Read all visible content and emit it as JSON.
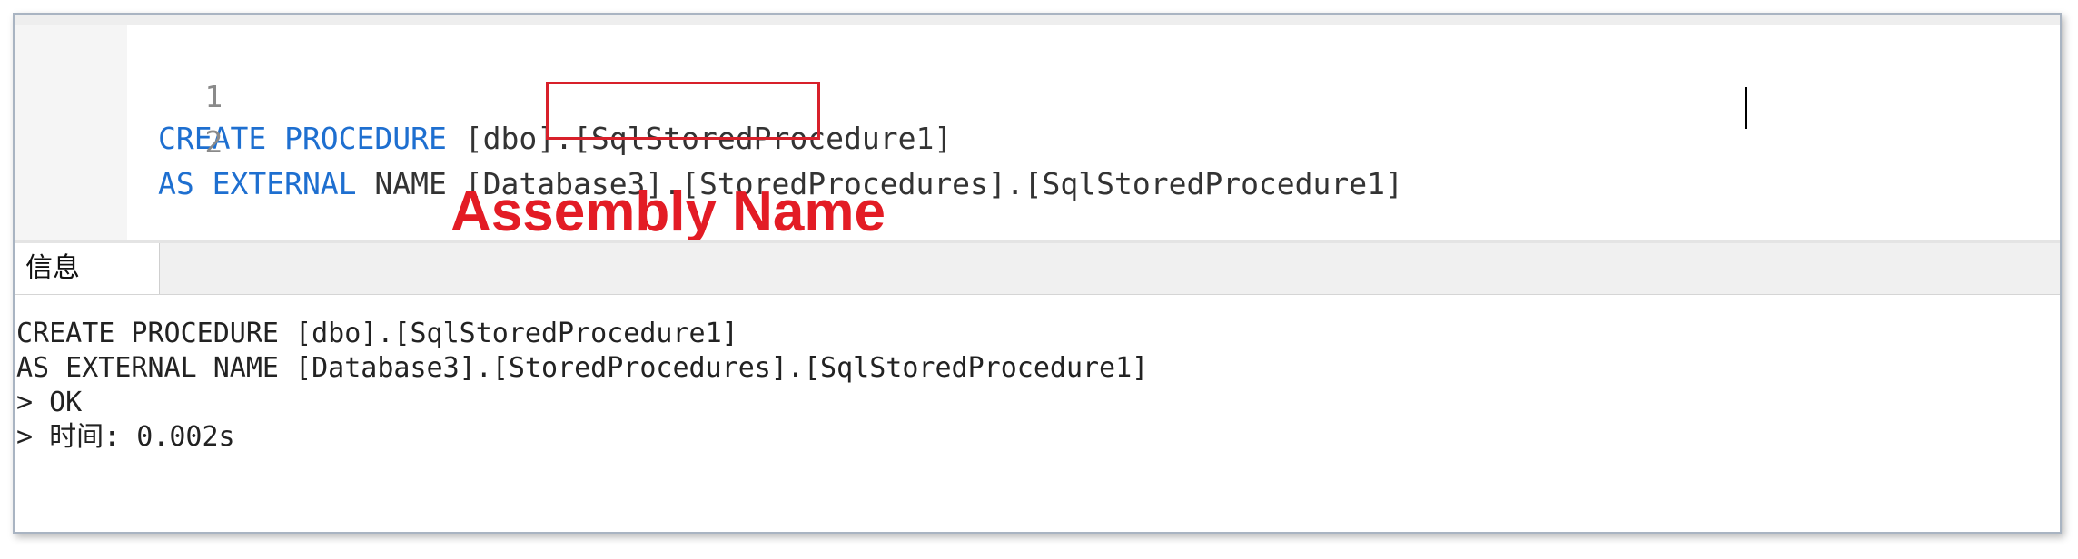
{
  "editor": {
    "lines": [
      {
        "number": "1",
        "keyword": "CREATE PROCEDURE",
        "rest": " [dbo].[SqlStoredProcedure1]"
      },
      {
        "number": "2",
        "keyword1": "AS EXTERNAL",
        "rest": " NAME [Database3].[StoredProcedures].[SqlStoredProcedure1]"
      }
    ]
  },
  "annotation": {
    "text": "Assembly Name",
    "color": "#e31c25"
  },
  "tabs": [
    {
      "label": "信息"
    }
  ],
  "output": {
    "lines": [
      "CREATE PROCEDURE [dbo].[SqlStoredProcedure1]",
      "AS EXTERNAL NAME [Database3].[StoredProcedures].[SqlStoredProcedure1]",
      "> OK",
      "> 时间: 0.002s"
    ]
  },
  "colors": {
    "keyword": "#1e6fd0",
    "highlight_box": "#d8202a"
  }
}
